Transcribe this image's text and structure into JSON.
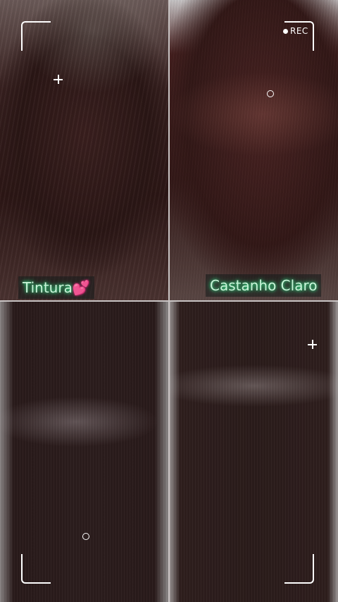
{
  "photos": [
    {
      "name": "before-top-left",
      "description_label": ""
    },
    {
      "name": "before-top-right",
      "description_label": ""
    },
    {
      "name": "after-bottom-left",
      "description_label": ""
    },
    {
      "name": "after-bottom-right",
      "description_label": ""
    }
  ],
  "captions": {
    "left_text": "Tintura",
    "left_emoji": "💕",
    "right_text": "Castanho Claro"
  },
  "camera_overlay": {
    "rec_label": "REC",
    "icons": [
      "record-dot-icon",
      "crosshair-plus-icon",
      "focus-ring-icon"
    ]
  },
  "colors": {
    "caption_text": "#c8f4d8",
    "caption_glow": "#39e08a",
    "overlay": "#ffffff"
  }
}
